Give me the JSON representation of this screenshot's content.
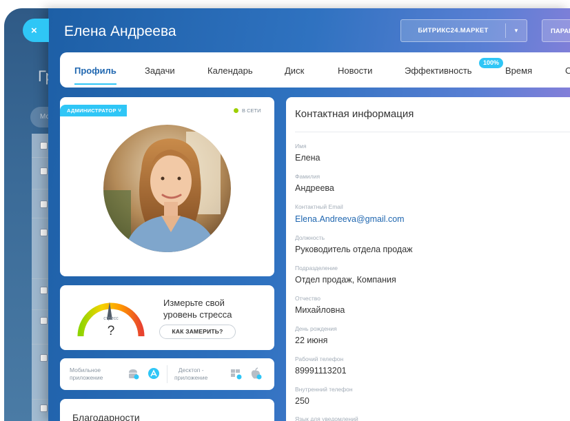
{
  "background": {
    "close_symbol": "×",
    "title_partial": "Гр",
    "search_partial": "Мо"
  },
  "header": {
    "title": "Елена Андреева",
    "market_button": "БИТРИКС24.МАРКЕТ",
    "params_button": "ПАРАМЕТРЫ"
  },
  "tabs": [
    {
      "label": "Профиль",
      "active": true
    },
    {
      "label": "Задачи"
    },
    {
      "label": "Календарь"
    },
    {
      "label": "Диск"
    },
    {
      "label": "Новости"
    },
    {
      "label": "Эффективность",
      "badge": "100%"
    },
    {
      "label": "Время"
    },
    {
      "label": "О"
    }
  ],
  "profile": {
    "role_badge": "АДМИНИСТРАТОР",
    "status": "В СЕТИ",
    "status_color": "#9dcf00"
  },
  "stress": {
    "gauge_label": "стресс",
    "gauge_value": "?",
    "text_line1": "Измерьте свой",
    "text_line2": "уровень стресса",
    "button": "КАК ЗАМЕРИТЬ?"
  },
  "apps": {
    "mobile_line1": "Мобильное",
    "mobile_line2": "приложение",
    "desktop_line1": "Десктоп -",
    "desktop_line2": "приложение"
  },
  "thanks": {
    "title": "Благодарности"
  },
  "contact": {
    "title": "Контактная информация",
    "fields": [
      {
        "label": "Имя",
        "value": "Елена"
      },
      {
        "label": "Фамилия",
        "value": "Андреева"
      },
      {
        "label": "Контактный Email",
        "value": "Elena.Andreeva@gmail.com"
      },
      {
        "label": "Должность",
        "value": "Руководитель отдела продаж"
      },
      {
        "label": "Подразделение",
        "value": "Отдел продаж, Компания"
      },
      {
        "label": "Отчество",
        "value": "Михайловна"
      },
      {
        "label": "День рождения",
        "value": "22 июня"
      },
      {
        "label": "Рабочий телефон",
        "value": "89991113201"
      },
      {
        "label": "Внутренний телефон",
        "value": "250"
      },
      {
        "label": "Язык для уведомлений",
        "value": ""
      }
    ]
  },
  "colors": {
    "accent": "#2fc6f6",
    "link": "#2067b0"
  }
}
